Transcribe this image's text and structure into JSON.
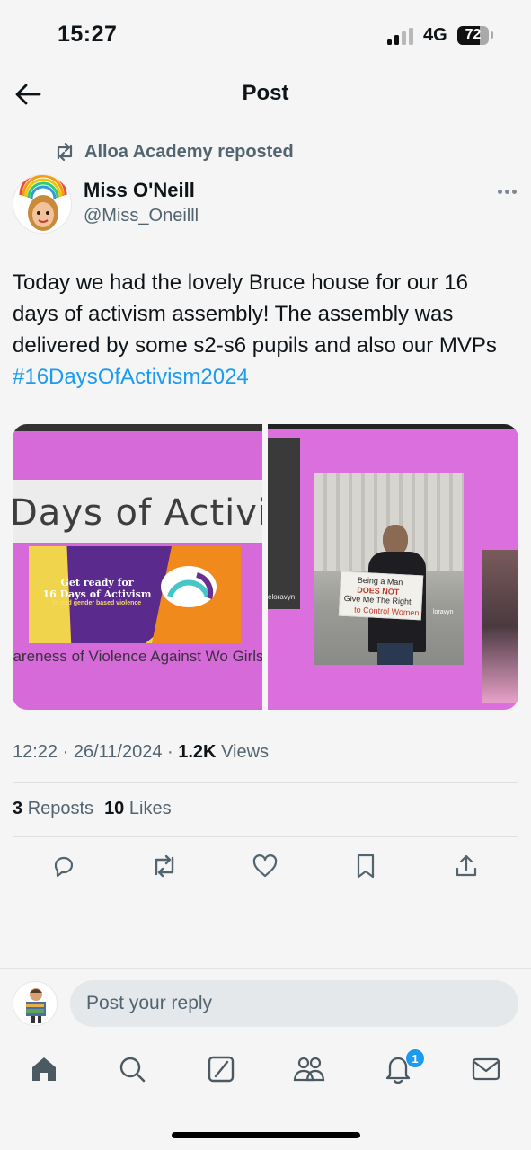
{
  "status_bar": {
    "time": "15:27",
    "network": "4G",
    "battery_level": "72",
    "battery_fraction": 0.72
  },
  "header": {
    "title": "Post"
  },
  "repost": {
    "label": "Alloa Academy reposted"
  },
  "author": {
    "name": "Miss O'Neill",
    "handle": "@Miss_Oneilll"
  },
  "tweet": {
    "text": "Today we had the lovely Bruce house for our 16 days of activism assembly! The assembly was delivered by some s2-s6 pupils and also our MVPs ",
    "hashtag": "#16DaysOfActivism2024"
  },
  "media": {
    "image1": {
      "title_text": "Days of Activis",
      "banner_line1": "Get ready for",
      "banner_line2": "16 Days of Activism",
      "banner_line3": "to end gender based violence",
      "subtitle": "areness of Violence Against Wo Girls"
    },
    "image2": {
      "sign_line1": "Being a Man",
      "sign_line2": "DOES NOT",
      "sign_line3": "Give Me The Right",
      "sign_line4": "to Control Women",
      "tag_left": "eloravyn",
      "tag_right": "loravyn"
    }
  },
  "meta": {
    "time": "12:22",
    "date": "26/11/2024",
    "views_count": "1.2K",
    "views_label": "Views"
  },
  "stats": {
    "reposts_count": "3",
    "reposts_label": "Reposts",
    "likes_count": "10",
    "likes_label": "Likes"
  },
  "reply": {
    "placeholder": "Post your reply"
  },
  "tabbar": {
    "notification_count": "1"
  },
  "colors": {
    "accent": "#1d9bf0",
    "secondary_text": "#536471",
    "background": "#f4f5f4"
  }
}
